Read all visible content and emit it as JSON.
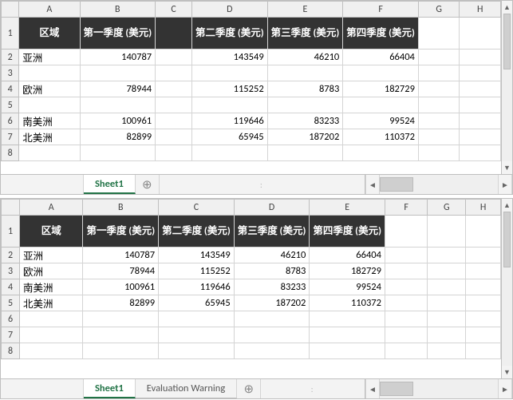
{
  "top": {
    "cols": [
      "A",
      "B",
      "C",
      "D",
      "E",
      "F",
      "G",
      "H"
    ],
    "rows": [
      "1",
      "2",
      "3",
      "4",
      "5",
      "6",
      "7",
      "8"
    ],
    "header": {
      "region": "区域",
      "q1": "第一季度 (美元)",
      "q2": "第二季度 (美元)",
      "q3": "第三季度 (美元)",
      "q4": "第四季度 (美元)"
    },
    "data": {
      "r2": {
        "label": "亚洲",
        "b": "140787",
        "d": "143549",
        "e": "46210",
        "f": "66404"
      },
      "r4": {
        "label": "欧洲",
        "b": "78944",
        "d": "115252",
        "e": "8783",
        "f": "182729"
      },
      "r6": {
        "label": "南美洲",
        "b": "100961",
        "d": "119646",
        "e": "83233",
        "f": "99524"
      },
      "r7": {
        "label": "北美洲",
        "b": "82899",
        "d": "65945",
        "e": "187202",
        "f": "110372"
      }
    },
    "tabs": {
      "sheet1": "Sheet1"
    }
  },
  "bottom": {
    "cols": [
      "A",
      "B",
      "C",
      "D",
      "E",
      "F",
      "G",
      "H"
    ],
    "rows": [
      "1",
      "2",
      "3",
      "4",
      "5",
      "6",
      "7",
      "8"
    ],
    "header": {
      "region": "区域",
      "q1": "第一季度 (美元)",
      "q2": "第二季度 (美元)",
      "q3": "第三季度 (美元)",
      "q4": "第四季度 (美元)"
    },
    "data": {
      "r2": {
        "label": "亚洲",
        "b": "140787",
        "c": "143549",
        "d": "46210",
        "e": "66404"
      },
      "r3": {
        "label": "欧洲",
        "b": "78944",
        "c": "115252",
        "d": "8783",
        "e": "182729"
      },
      "r4": {
        "label": "南美洲",
        "b": "100961",
        "c": "119646",
        "d": "83233",
        "e": "99524"
      },
      "r5": {
        "label": "北美洲",
        "b": "82899",
        "c": "65945",
        "d": "187202",
        "e": "110372"
      }
    },
    "tabs": {
      "sheet1": "Sheet1",
      "eval": "Evaluation Warning"
    }
  },
  "glyphs": {
    "plus": "⊕",
    "dots": ":",
    "left": "◄",
    "right": "►",
    "up": "▲",
    "down": "▼"
  }
}
